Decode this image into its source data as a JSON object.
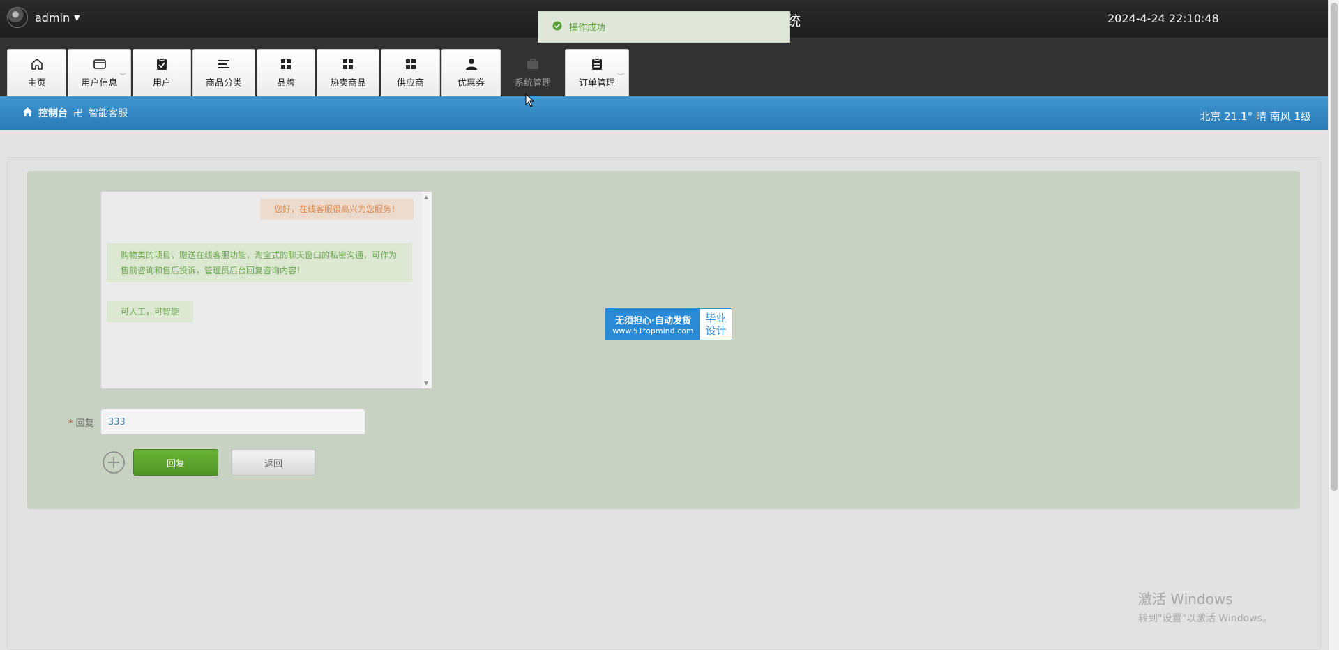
{
  "header": {
    "username": "admin",
    "title_fragment": "统",
    "datetime": "2024-4-24 22:10:48"
  },
  "toast": {
    "message": "操作成功",
    "color": "#5aa03a"
  },
  "nav": {
    "items": [
      {
        "label": "主页",
        "icon": "home-icon"
      },
      {
        "label": "用户信息",
        "icon": "wallet-icon",
        "dropdown": true
      },
      {
        "label": "用户",
        "icon": "clipboard-check-icon"
      },
      {
        "label": "商品分类",
        "icon": "list-icon"
      },
      {
        "label": "品牌",
        "icon": "grid-icon"
      },
      {
        "label": "热卖商品",
        "icon": "grid-icon"
      },
      {
        "label": "供应商",
        "icon": "grid-icon"
      },
      {
        "label": "优惠券",
        "icon": "person-icon"
      },
      {
        "label": "系统管理",
        "icon": "briefcase-icon"
      },
      {
        "label": "订单管理",
        "icon": "clipboard-icon",
        "dropdown": true
      }
    ]
  },
  "breadcrumb": {
    "home": "控制台",
    "separator": "卍",
    "current": "智能客服"
  },
  "weather": "北京  21.1°  晴  南风  1级",
  "chat": {
    "messages": [
      {
        "side": "right",
        "text": "您好，在线客服很高兴为您服务！"
      },
      {
        "side": "left",
        "text": "购物类的项目，赠送在线客服功能，淘宝式的聊天窗口的私密沟通，可作为售前咨询和售后投诉，管理员后台回复咨询内容！"
      },
      {
        "side": "left",
        "text": "可人工，可智能"
      }
    ]
  },
  "form": {
    "required_mark": "*",
    "reply_label": "回复",
    "reply_value": "333",
    "reply_button": "回复",
    "back_button": "返回"
  },
  "watermark": {
    "line1": "无须担心·自动发货",
    "line2": "www.51topmind.com",
    "right1": "毕业",
    "right2": "设计"
  },
  "windows_activation": {
    "line1": "激活 Windows",
    "line2": "转到\"设置\"以激活 Windows。"
  },
  "colors": {
    "topbar": "#222222",
    "crumbbar": "#3a8fc8",
    "green_panel": "#c8d2c2",
    "primary_button": "#5aa32d"
  }
}
